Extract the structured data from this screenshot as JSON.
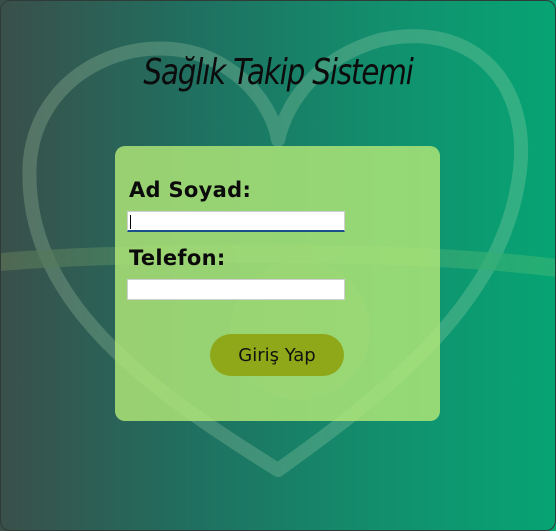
{
  "page": {
    "title": "Sağlık Takip Sistemi"
  },
  "form": {
    "name_label": "Ad Soyad:",
    "name_value": "",
    "phone_label": "Telefon:",
    "phone_value": "",
    "submit_label": "Giriş Yap"
  },
  "colors": {
    "card": "#b2e878",
    "button": "#8fa81a",
    "background_left": "#3a4f4a",
    "background_right": "#06a473"
  }
}
